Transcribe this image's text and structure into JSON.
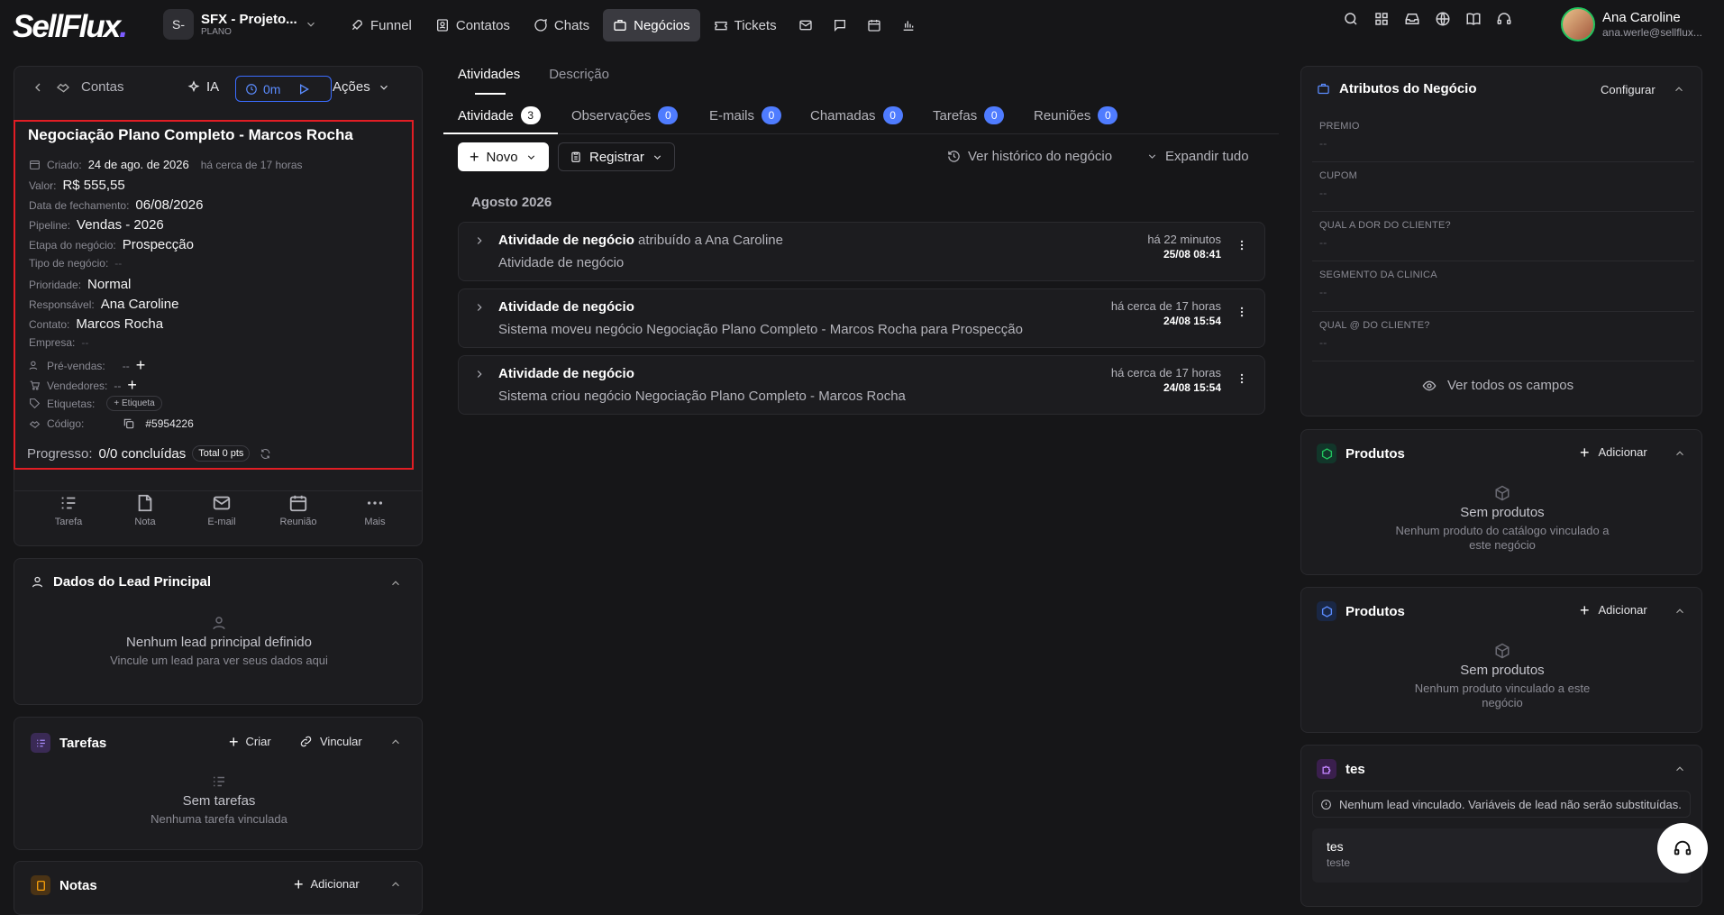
{
  "nav": {
    "logo": "SellFlux",
    "workspace_initials": "S-",
    "workspace_name": "SFX - Projeto...",
    "workspace_plan": "PLANO",
    "items": [
      {
        "label": "Funnel",
        "icon": "rocket-icon"
      },
      {
        "label": "Contatos",
        "icon": "contacts-icon"
      },
      {
        "label": "Chats",
        "icon": "chat-icon"
      },
      {
        "label": "Negócios",
        "icon": "briefcase-icon"
      },
      {
        "label": "Tickets",
        "icon": "ticket-icon"
      }
    ],
    "user_name": "Ana Caroline",
    "user_email": "ana.werle@sellflux..."
  },
  "left": {
    "back_label": "Contas",
    "ai_label": "IA",
    "timer": "0m",
    "actions_label": "Ações",
    "deal_title": "Negociação Plano Completo - Marcos Rocha",
    "created_label": "Criado:",
    "created_value": "24 de ago. de 2026",
    "created_ago": "há cerca de 17 horas",
    "fields": [
      {
        "label": "Valor:",
        "value": "R$ 555,55"
      },
      {
        "label": "Data de fechamento:",
        "value": "06/08/2026"
      },
      {
        "label": "Pipeline:",
        "value": "Vendas - 2026"
      },
      {
        "label": "Etapa do negócio:",
        "value": "Prospecção"
      },
      {
        "label": "Tipo de negócio:",
        "value": "--"
      },
      {
        "label": "Prioridade:",
        "value": "Normal"
      },
      {
        "label": "Responsável:",
        "value": "Ana Caroline"
      },
      {
        "label": "Contato:",
        "value": "Marcos Rocha"
      },
      {
        "label": "Empresa:",
        "value": "--"
      }
    ],
    "presales_label": "Pré-vendas:",
    "presales_value": "--",
    "sellers_label": "Vendedores:",
    "sellers_value": "--",
    "tags_label": "Etiquetas:",
    "tag_button": "+ Etiqueta",
    "code_label": "Código:",
    "code_value": "#5954226",
    "progress_label": "Progresso:",
    "progress_value": "0/0 concluídas",
    "progress_pts": "Total 0 pts",
    "quick": [
      "Tarefa",
      "Nota",
      "E-mail",
      "Reunião",
      "Mais"
    ],
    "lead": {
      "title": "Dados do Lead Principal",
      "empty_title": "Nenhum lead principal definido",
      "empty_desc": "Vincule um lead para ver seus dados aqui"
    },
    "tasks": {
      "title": "Tarefas",
      "create": "Criar",
      "link": "Vincular",
      "empty_title": "Sem tarefas",
      "empty_desc": "Nenhuma tarefa vinculada"
    },
    "notes": {
      "title": "Notas",
      "add": "Adicionar"
    }
  },
  "center": {
    "top_tabs": [
      "Atividades",
      "Descrição"
    ],
    "tabs": [
      {
        "label": "Atividade",
        "count": "3"
      },
      {
        "label": "Observações",
        "count": "0"
      },
      {
        "label": "E-mails",
        "count": "0"
      },
      {
        "label": "Chamadas",
        "count": "0"
      },
      {
        "label": "Tarefas",
        "count": "0"
      },
      {
        "label": "Reuniões",
        "count": "0"
      }
    ],
    "new_label": "Novo",
    "register_label": "Registrar",
    "history_label": "Ver histórico do negócio",
    "expand_label": "Expandir tudo",
    "month": "Agosto 2026",
    "activities": [
      {
        "title": "Atividade de negócio",
        "assigned": "atribuído a Ana Caroline",
        "desc": "Atividade de negócio",
        "ago": "há 22 minutos",
        "date": "25/08 08:41"
      },
      {
        "title": "Atividade de negócio",
        "assigned": "",
        "desc": "Sistema moveu negócio Negociação Plano Completo - Marcos Rocha para Prospecção",
        "ago": "há cerca de 17 horas",
        "date": "24/08 15:54"
      },
      {
        "title": "Atividade de negócio",
        "assigned": "",
        "desc": "Sistema criou negócio Negociação Plano Completo - Marcos Rocha",
        "ago": "há cerca de 17 horas",
        "date": "24/08 15:54"
      }
    ]
  },
  "right": {
    "attrs_title": "Atributos do Negócio",
    "configure": "Configurar",
    "attrs": [
      {
        "label": "PREMIO",
        "value": "--"
      },
      {
        "label": "CUPOM",
        "value": "--"
      },
      {
        "label": "QUAL A DOR DO CLIENTE?",
        "value": "--"
      },
      {
        "label": "SEGMENTO DA CLINICA",
        "value": "--"
      },
      {
        "label": "QUAL @ DO CLIENTE?",
        "value": "--"
      }
    ],
    "see_all": "Ver todos os campos",
    "products1": {
      "title": "Produtos",
      "add": "Adicionar",
      "empty_title": "Sem produtos",
      "empty_desc": "Nenhum produto do catálogo vinculado a este negócio"
    },
    "products2": {
      "title": "Produtos",
      "add": "Adicionar",
      "empty_title": "Sem produtos",
      "empty_desc": "Nenhum produto vinculado a este negócio"
    },
    "tes": {
      "title": "tes",
      "notice": "Nenhum lead vinculado. Variáveis de lead não serão substituídas.",
      "item_title": "tes",
      "item_sub": "teste"
    }
  }
}
